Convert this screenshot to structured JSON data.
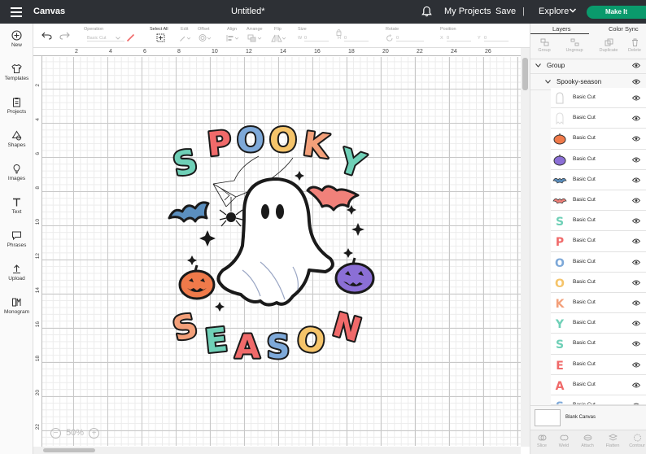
{
  "header": {
    "app_name": "Canvas",
    "doc_title": "Untitled*",
    "my_projects": "My Projects",
    "save": "Save",
    "separator": "|",
    "explore": "Explore",
    "make_it": "Make It"
  },
  "rail": {
    "items": [
      {
        "label": "New",
        "icon": "plus-circle-icon"
      },
      {
        "label": "Templates",
        "icon": "shirt-icon"
      },
      {
        "label": "Projects",
        "icon": "clipboard-icon"
      },
      {
        "label": "Shapes",
        "icon": "shapes-icon"
      },
      {
        "label": "Images",
        "icon": "lightbulb-icon"
      },
      {
        "label": "Text",
        "icon": "text-icon"
      },
      {
        "label": "Phrases",
        "icon": "speech-bubble-icon"
      },
      {
        "label": "Upload",
        "icon": "upload-icon"
      },
      {
        "label": "Monogram",
        "icon": "monogram-icon"
      }
    ]
  },
  "toolbar": {
    "operation_label": "Operation",
    "operation_value": "Basic Cut",
    "select_all": "Select All",
    "edit": "Edit",
    "offset": "Offset",
    "align": "Align",
    "arrange": "Arrange",
    "flip": "Flip",
    "size": "Size",
    "size_w": "W",
    "size_w_value": "0",
    "size_h": "H",
    "size_h_value": "0",
    "rotate": "Rotate",
    "rotate_value": "0",
    "position": "Position",
    "pos_x": "X",
    "pos_x_value": "0",
    "pos_y": "Y",
    "pos_y_value": "0"
  },
  "ruler": {
    "top": [
      "2",
      "4",
      "6",
      "8",
      "10",
      "12",
      "14",
      "16",
      "18",
      "20",
      "22",
      "24",
      "26"
    ],
    "left": [
      "2",
      "4",
      "6",
      "8",
      "10",
      "12",
      "14",
      "16",
      "18",
      "20",
      "22"
    ]
  },
  "zoom": {
    "value": "50%",
    "minus": "−",
    "plus": "+"
  },
  "panel": {
    "tabs": [
      "Layers",
      "Color Sync"
    ],
    "actions": [
      "Group",
      "Ungroup",
      "Duplicate",
      "Delete"
    ],
    "group_label": "Group",
    "subgroup_label": "Spooky-season",
    "layers": [
      {
        "label": "Basic Cut",
        "color": "#ffffff",
        "icon": "ghost-outline-icon"
      },
      {
        "label": "Basic Cut",
        "color": "#ffffff",
        "icon": "ghost-icon"
      },
      {
        "label": "Basic Cut",
        "color": "#f07a4a",
        "icon": "pumpkin-icon"
      },
      {
        "label": "Basic Cut",
        "color": "#8b6fd6",
        "icon": "pumpkin-icon"
      },
      {
        "label": "Basic Cut",
        "color": "#5b8fbf",
        "icon": "bat-icon"
      },
      {
        "label": "Basic Cut",
        "color": "#f0817a",
        "icon": "bat-icon"
      },
      {
        "label": "Basic Cut",
        "color": "#6fd0b7",
        "icon": "letter-s-icon"
      },
      {
        "label": "Basic Cut",
        "color": "#f06a6a",
        "icon": "letter-p-icon"
      },
      {
        "label": "Basic Cut",
        "color": "#7ea9d9",
        "icon": "letter-o-icon"
      },
      {
        "label": "Basic Cut",
        "color": "#f5c46a",
        "icon": "letter-o-icon"
      },
      {
        "label": "Basic Cut",
        "color": "#f3a07a",
        "icon": "letter-k-icon"
      },
      {
        "label": "Basic Cut",
        "color": "#6fd0b7",
        "icon": "letter-y-icon"
      },
      {
        "label": "Basic Cut",
        "color": "#6fd0b7",
        "icon": "letter-s-icon"
      },
      {
        "label": "Basic Cut",
        "color": "#f06a6a",
        "icon": "letter-e-icon"
      },
      {
        "label": "Basic Cut",
        "color": "#f06a6a",
        "icon": "letter-a-icon"
      },
      {
        "label": "Basic Cut",
        "color": "#7ea9d9",
        "icon": "letter-s-icon"
      }
    ],
    "blank_canvas": "Blank Canvas",
    "bottom_actions": [
      "Slice",
      "Weld",
      "Attach",
      "Flatten",
      "Contour"
    ]
  },
  "artwork": {
    "word_top": "SPOOKY",
    "word_bottom": "SEASON",
    "colors": {
      "teal": "#6fd0b7",
      "red": "#f06a6a",
      "blue": "#7ea9d9",
      "yellow": "#f5c46a",
      "orange": "#f3a07a",
      "purple": "#8b6fd6",
      "outline": "#1a1a1a"
    }
  },
  "colors": {
    "topbar": "#2d3035",
    "make_it": "#0a9a6c",
    "accent": "#0a9a6c"
  }
}
